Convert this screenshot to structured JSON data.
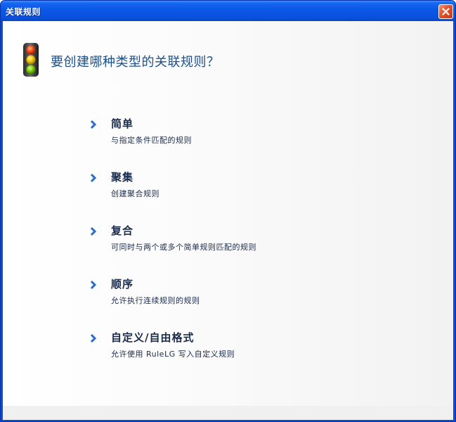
{
  "window": {
    "title": "关联规则"
  },
  "heading": "要创建哪种类型的关联规则？",
  "options": [
    {
      "title": "简单",
      "description": "与指定条件匹配的规则"
    },
    {
      "title": "聚集",
      "description": "创建聚合规则"
    },
    {
      "title": "复合",
      "description": "可同时与两个或多个简单规则匹配的规则"
    },
    {
      "title": "顺序",
      "description": "允许执行连续规则的规则"
    },
    {
      "title": "自定义/自由格式",
      "description": "允许使用 RuleLG 写入自定义规则"
    }
  ],
  "icons": {
    "close": "close-icon",
    "header": "traffic-light-icon",
    "option_arrow": "chevron-right-icon"
  },
  "colors": {
    "titlebar": "#0a52de",
    "heading": "#1f4f86",
    "option_text": "#1a2b4c",
    "arrow": "#2a6cc8",
    "close_button": "#e1512b"
  }
}
